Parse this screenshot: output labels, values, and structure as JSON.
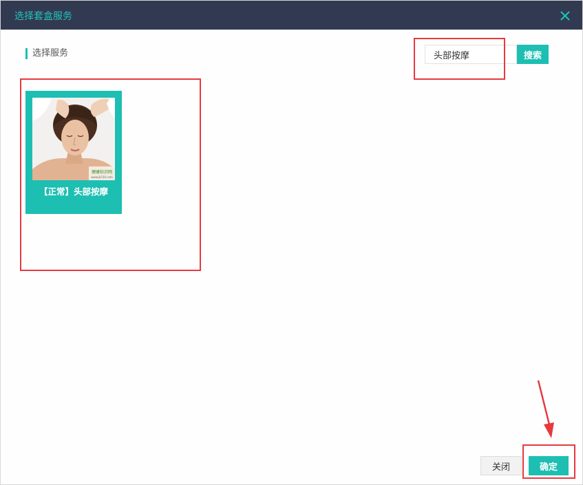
{
  "dialog": {
    "title": "选择套盒服务",
    "section_title": "选择服务"
  },
  "search": {
    "value": "头部按摩",
    "button_label": "搜索"
  },
  "services": [
    {
      "label": "【正常】头部按摩",
      "image_icon": "head-massage-photo",
      "watermark_text": "健康知识网",
      "watermark_url": "www.jk510.com"
    }
  ],
  "footer": {
    "close_label": "关闭",
    "confirm_label": "确定"
  },
  "colors": {
    "titlebar": "#323a52",
    "accent": "#1cbfb2",
    "highlight": "#e6393f"
  }
}
